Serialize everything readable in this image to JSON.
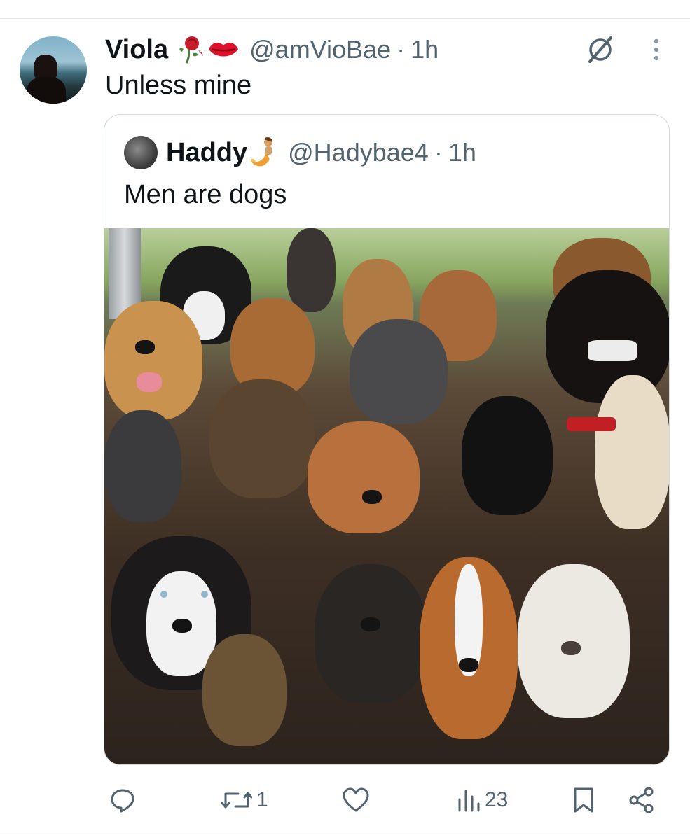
{
  "post": {
    "author_name": "Viola",
    "author_emojis": [
      "wilted-rose-emoji",
      "kiss-mark-emoji"
    ],
    "handle": "@amVioBae",
    "separator": "·",
    "time": "1h",
    "text": "Unless mine"
  },
  "quoted": {
    "author_name": "Haddy",
    "author_emoji": "mermaid-emoji",
    "handle": "@Hadybae4",
    "separator": "·",
    "time": "1h",
    "text": "Men are dogs",
    "media_description_icon": "dog-group-photo"
  },
  "actions": {
    "reply_count": "",
    "repost_count": "1",
    "like_count": "",
    "views_count": "23"
  },
  "icons": [
    "grok-icon",
    "more-icon",
    "reply-icon",
    "repost-icon",
    "like-icon",
    "views-icon",
    "bookmark-icon",
    "share-icon"
  ],
  "colors": {
    "text": "#0f1419",
    "secondary": "#536471",
    "border": "#cfd9de"
  }
}
